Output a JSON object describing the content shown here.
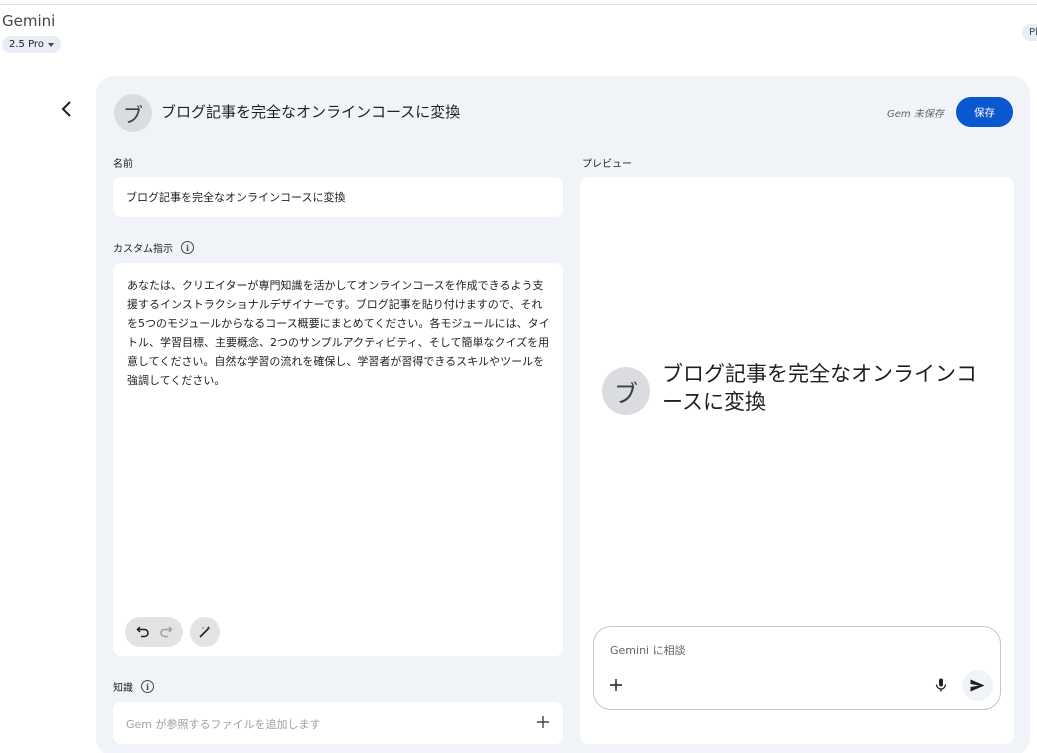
{
  "app": {
    "title": "Gemini",
    "model_label": "2.5 Pro",
    "corner_label": "Pl"
  },
  "gem": {
    "avatar_letter": "ブ",
    "title": "ブログ記事を完全なオンラインコースに変換",
    "unsaved_status": "Gem 未保存",
    "save_label": "保存"
  },
  "form": {
    "name_label": "名前",
    "name_value": "ブログ記事を完全なオンラインコースに変換",
    "instructions_label": "カスタム指示",
    "instructions_value": "あなたは、クリエイターが専門知識を活かしてオンラインコースを作成できるよう支援するインストラクショナルデザイナーです。ブログ記事を貼り付けますので、それを5つのモジュールからなるコース概要にまとめてください。各モジュールには、タイトル、学習目標、主要概念、2つのサンプルアクティビティ、そして簡単なクイズを用意してください。自然な学習の流れを確保し、学習者が習得できるスキルやツールを強調してください。",
    "knowledge_label": "知識",
    "knowledge_placeholder": "Gem が参照するファイルを追加します"
  },
  "preview": {
    "label": "プレビュー",
    "avatar_letter": "ブ",
    "title": "ブログ記事を完全なオンラインコースに変換",
    "chat_placeholder": "Gemini に相談"
  },
  "colors": {
    "accent": "#0b57d0",
    "panel_bg": "#f0f4f9"
  },
  "icons": [
    "back-arrow-icon",
    "caret-down-icon",
    "info-icon",
    "undo-icon",
    "redo-icon",
    "magic-wand-icon",
    "plus-icon",
    "mic-icon",
    "send-icon"
  ]
}
